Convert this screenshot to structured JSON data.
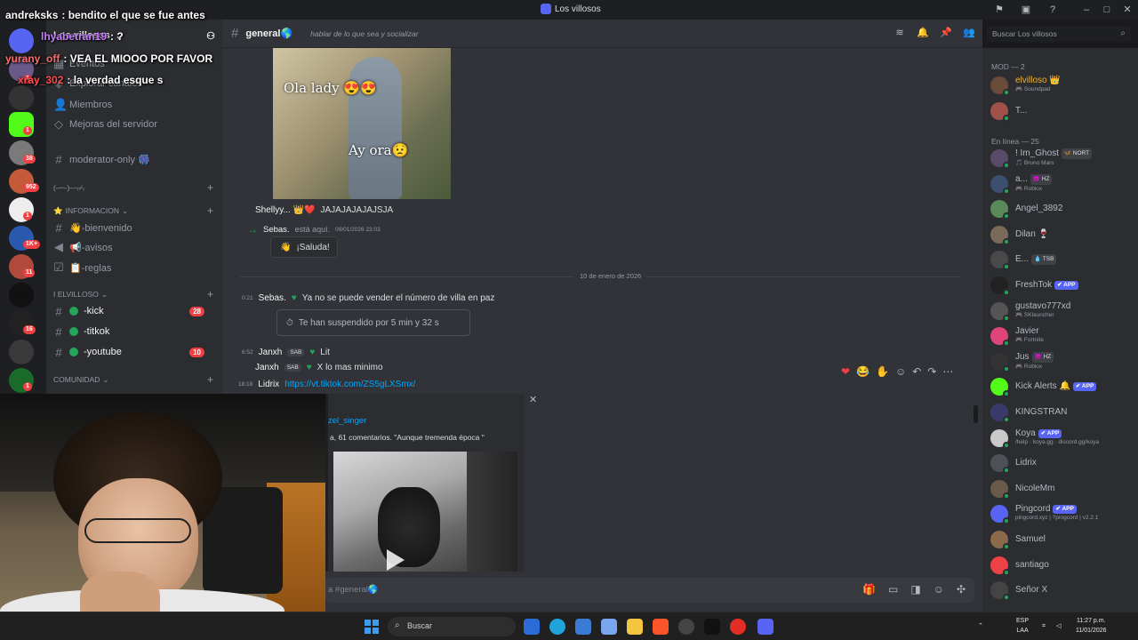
{
  "window": {
    "title": "Los villosos"
  },
  "server": {
    "name": "Los villosos"
  },
  "sidebar": {
    "top_items": [
      {
        "label": "Eventos"
      },
      {
        "label": "Explorar canales"
      },
      {
        "label": "Miembros"
      },
      {
        "label": "Mejoras del servidor"
      }
    ],
    "channels_pre": [
      {
        "label": "moderator-only 🎆"
      }
    ],
    "categories": [
      {
        "label": "(–ᵕ–)—ᵢ⌿ᵣ"
      },
      {
        "label": "INFORMACION"
      },
      {
        "label": "I elvilloso"
      },
      {
        "label": "COMUNIDAD"
      }
    ],
    "info_channels": [
      {
        "label": "👋-bienvenido"
      },
      {
        "label": "📢-avisos"
      },
      {
        "label": "📋-reglas"
      }
    ],
    "villoso_channels": [
      {
        "label": "-kick",
        "badge": "28"
      },
      {
        "label": "-titkok",
        "badge": ""
      },
      {
        "label": "-youtube",
        "badge": "10"
      }
    ],
    "current_channel": "general"
  },
  "rail_badges": [
    "1",
    "1",
    "38",
    "952",
    "1",
    "1K+",
    "11",
    "16",
    "1"
  ],
  "header": {
    "channel": "general🌎",
    "topic": "hablar de lo que sea y socializar",
    "search_placeholder": "Buscar Los villosos"
  },
  "messages": {
    "image_caption_top": "Ola lady 😍😍",
    "image_caption_bottom": "Ay ora😟",
    "shelly_name": "Shellyy... 👑❤️",
    "shelly_text": "JAJAJAJAJAJSJA",
    "sebas_join_name": "Sebas.",
    "sebas_join_text": "está aquí.",
    "sebas_join_ts": "09/01/2026 23:03",
    "saluda_label": "¡Saluda!",
    "date_divider": "10 de enero de 2026",
    "m1_ts": "0:21",
    "m1_name": "Sebas.",
    "m1_text": "Ya no se puede vender el número de villa en paz",
    "suspended_text": "Te han suspendido por 5 min y 32 s",
    "m2_ts": "6:52",
    "m2_name": "Janxh",
    "m2_tag": "SAB",
    "m2_text": "Lit",
    "m3_name": "Janxh",
    "m3_tag": "SAB",
    "m3_text": "X lo mas minimo",
    "m4_ts": "18:18",
    "m4_name": "Lidrix",
    "m4_link": "https://vt.tiktok.com/ZS5gLXSmx/"
  },
  "embed": {
    "author": "zel_singer",
    "desc": "a, 61 comentarios. \"Aunque tremenda época \""
  },
  "input": {
    "placeholder": "a #general🌎"
  },
  "members": {
    "mod_header": "MOD — 2",
    "online_header": "En línea — 25",
    "mods": [
      {
        "name": "elvilloso 👑",
        "sub": "🎮 Soundpad",
        "color": "#f0b232",
        "av": "#6b4b3a"
      },
      {
        "name": "T...",
        "sub": "",
        "color": "#dbdee1",
        "av": "#a0524a"
      }
    ],
    "online": [
      {
        "name": "! Im_Ghost",
        "tag": "🦋 NORT",
        "sub": "🎵 Bruno Mars",
        "av": "#5a4a6a",
        "app": false
      },
      {
        "name": "a...",
        "tag": "😈 HZ",
        "sub": "🎮 Roblox",
        "av": "#3d4f70",
        "app": false
      },
      {
        "name": "Angel_3892",
        "tag": "",
        "sub": "",
        "av": "#5a8a5a",
        "app": false
      },
      {
        "name": "Dilan 🍷",
        "tag": "",
        "sub": "",
        "av": "#7a6a5a",
        "app": false
      },
      {
        "name": "E...",
        "tag": "💧 TSB",
        "sub": "",
        "av": "#4a4a4a",
        "app": false
      },
      {
        "name": "FreshTok",
        "tag": "✔ APP",
        "sub": "",
        "av": "#222222",
        "app": true
      },
      {
        "name": "gustavo777xd",
        "tag": "",
        "sub": "🎮 SKlauncher",
        "av": "#555555",
        "app": false
      },
      {
        "name": "Javier",
        "tag": "",
        "sub": "🎮 Fortnite",
        "av": "#e0457a",
        "app": false
      },
      {
        "name": "Jus",
        "tag": "😈 HZ",
        "sub": "🎮 Roblox",
        "av": "#333333",
        "app": false
      },
      {
        "name": "Kick Alerts 🔔",
        "tag": "✔ APP",
        "sub": "",
        "av": "#53fc18",
        "app": true
      },
      {
        "name": "KINGSTRAN",
        "tag": "",
        "sub": "",
        "av": "#3a3a6a",
        "app": false
      },
      {
        "name": "Koya",
        "tag": "✔ APP",
        "sub": "/help · koya.gg · discord.gg/koya",
        "av": "#c9c9c9",
        "app": true
      },
      {
        "name": "Lidrix",
        "tag": "",
        "sub": "",
        "av": "#4e5058",
        "app": false
      },
      {
        "name": "NicoleMm",
        "tag": "",
        "sub": "",
        "av": "#6a5a4a",
        "app": false
      },
      {
        "name": "Pingcord",
        "tag": "✔ APP",
        "sub": "pingcord.xyz | ?pingcord | v2.2.1",
        "av": "#5865f2",
        "app": true
      },
      {
        "name": "Samuel",
        "tag": "",
        "sub": "",
        "av": "#8a6a4a",
        "app": false
      },
      {
        "name": "santiago",
        "tag": "",
        "sub": "",
        "av": "#ed4245",
        "app": false
      },
      {
        "name": "Señor X",
        "tag": "",
        "sub": "",
        "av": "#444444",
        "app": false
      }
    ]
  },
  "taskbar": {
    "search": "Buscar",
    "lang": "ESP",
    "lang2": "LAA",
    "time": "11:27 p.m.",
    "date": "11/01/2026"
  },
  "stream_chat": [
    {
      "user": "andreksks",
      "text": ": bendito el que se fue antes",
      "color": "#ffffff"
    },
    {
      "user": "lhyabetran19",
      "text": ": ?",
      "color": "#c77dff"
    },
    {
      "user": "yurany_off",
      "text": ": VEA EL MIOOO POR FAVOR",
      "color": "#ff6b6b"
    },
    {
      "user": "xray_302",
      "text": ": la verdad esque s",
      "color": "#ff4d4d"
    }
  ],
  "colors": {
    "accent": "#5865f2",
    "online": "#23a55a",
    "mention": "#f23f43",
    "link": "#00a8fc"
  }
}
